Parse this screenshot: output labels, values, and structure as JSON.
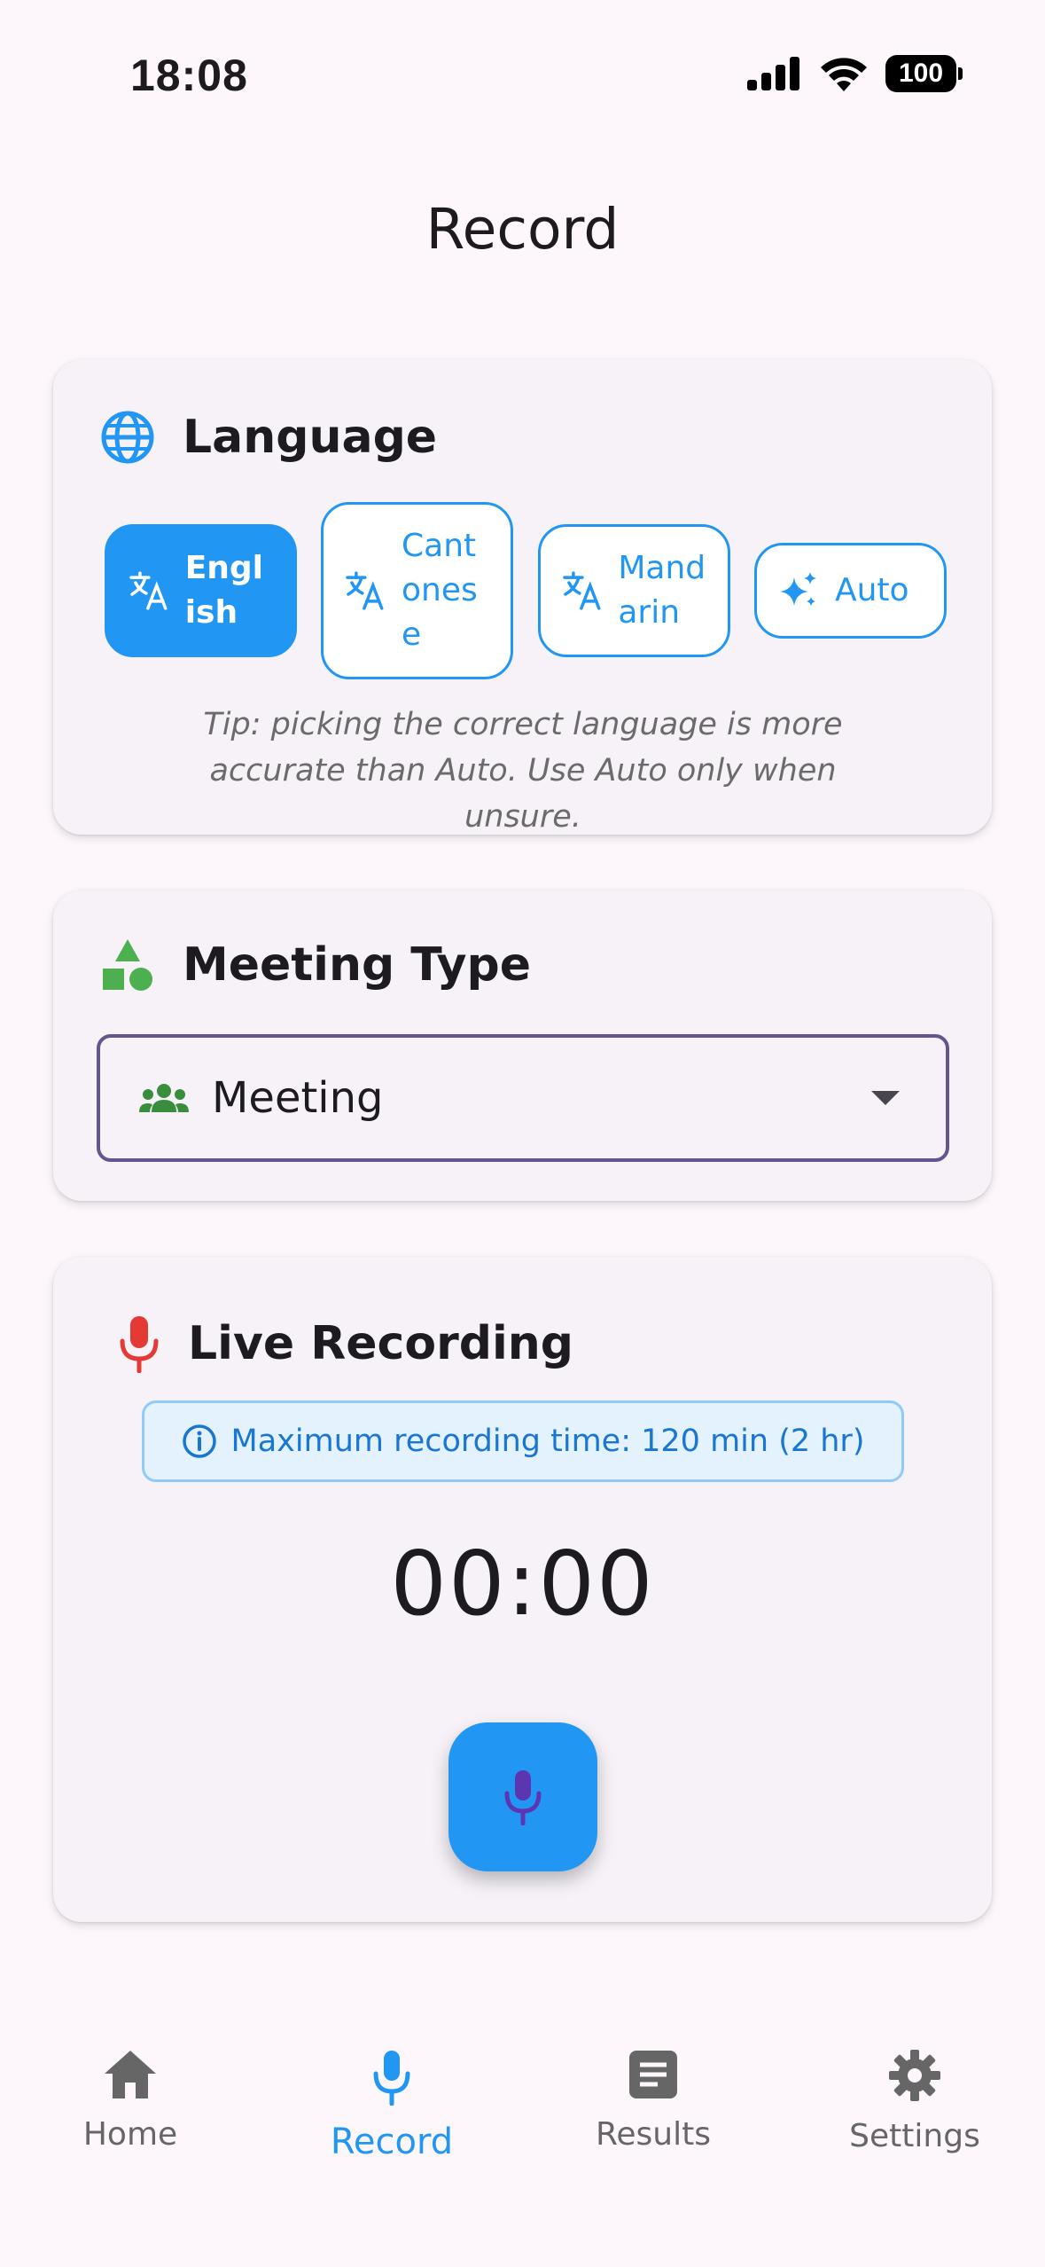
{
  "status": {
    "time": "18:08",
    "battery": "100"
  },
  "page": {
    "title": "Record"
  },
  "language": {
    "title": "Language",
    "options": [
      {
        "label": "English",
        "icon": "translate-icon",
        "selected": true
      },
      {
        "label": "Cantonese",
        "icon": "translate-icon",
        "selected": false
      },
      {
        "label": "Mandarin",
        "icon": "translate-icon",
        "selected": false
      },
      {
        "label": "Auto",
        "icon": "sparkle-icon",
        "selected": false
      }
    ],
    "tip": "Tip: picking the correct language is more accurate than Auto. Use Auto only when unsure."
  },
  "meeting_type": {
    "title": "Meeting Type",
    "selected": "Meeting"
  },
  "recording": {
    "title": "Live Recording",
    "info": "Maximum recording time: 120 min (2 hr)",
    "timer": "00:00"
  },
  "nav": {
    "items": [
      {
        "label": "Home",
        "icon": "home-icon",
        "active": false
      },
      {
        "label": "Record",
        "icon": "mic-icon",
        "active": true
      },
      {
        "label": "Results",
        "icon": "document-icon",
        "active": false
      },
      {
        "label": "Settings",
        "icon": "gear-icon",
        "active": false
      }
    ]
  },
  "colors": {
    "accent": "#2196f3",
    "dropdown_border": "#65558f",
    "mic_red": "#e53935",
    "shapes_green": "#4caf50"
  }
}
